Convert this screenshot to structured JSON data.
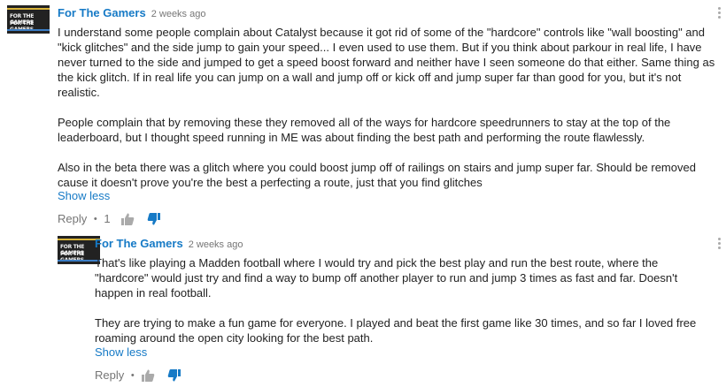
{
  "colors": {
    "link": "#167ac6",
    "muted": "#767676",
    "text": "#222222",
    "dislike_active": "#167ac6",
    "like_idle": "#aaaaaa"
  },
  "comments": [
    {
      "author": "For The Gamers",
      "time": "2 weeks ago",
      "avatar_text": [
        "FOR THE GAMERS",
        "FOR THE GAMERS"
      ],
      "paragraphs": [
        "I understand some people complain about Catalyst because it got rid of some of the \"hardcore\" controls like \"wall boosting\" and \"kick glitches\" and the side jump to gain your speed... I even used to use them. But if you think about parkour in real life, I have never turned to the side and jumped to get a speed boost forward and neither have I seen someone do that either. Same thing as the kick glitch. If in real life you can jump on a wall and jump off or kick off and jump super far than good for you, but it's not realistic.",
        "People complain that by removing these they removed all of the ways for hardcore speedrunners to stay at the top of the leaderboard, but I thought speed running in ME was about finding the best path and performing the route flawlessly.",
        "Also in the beta there was a glitch where you could boost jump off of railings on stairs and jump super far.  Should be removed cause it doesn't prove you're the best a perfecting a route, just that you find glitches"
      ],
      "show_less": "Show less",
      "reply": "Reply",
      "separator": "•",
      "likes": "1",
      "icons": {
        "like": "thumbs-up-icon",
        "dislike": "thumbs-down-icon",
        "menu": "vertical-ellipsis-icon"
      }
    },
    {
      "author": "For The Gamers",
      "time": "2 weeks ago",
      "avatar_text": [
        "FOR THE GAMERS",
        "FOR THE GAMERS"
      ],
      "paragraphs": [
        "That's like playing a Madden football where I would try and pick the best play and run the best route, where the \"hardcore\" would just try and find a way to bump off another player to run and jump 3 times as fast and far. Doesn't happen in real football.",
        "They are trying to make a fun game for everyone. I played and beat the first game like 30 times,  and so far I loved free roaming around the open city looking for the best path."
      ],
      "show_less": "Show less",
      "reply": "Reply",
      "separator": "•",
      "likes": "",
      "icons": {
        "like": "thumbs-up-icon",
        "dislike": "thumbs-down-icon",
        "menu": "vertical-ellipsis-icon"
      }
    }
  ]
}
